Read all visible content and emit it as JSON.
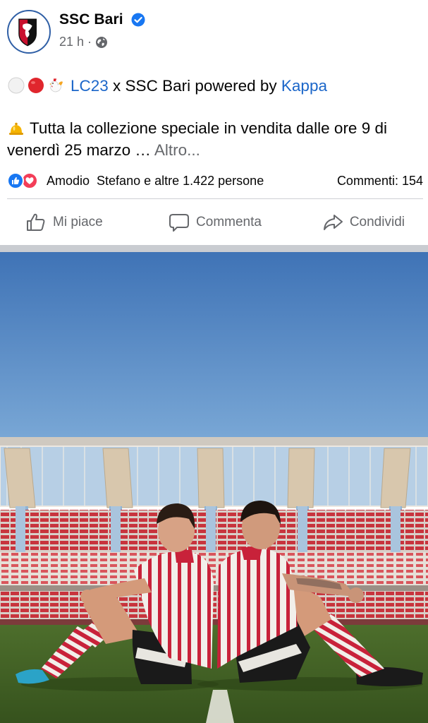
{
  "post": {
    "page_name": "SSC Bari",
    "time": "21 h",
    "separator": "·",
    "line1": {
      "link_lc23": "LC23",
      "middle": " x SSC Bari powered by ",
      "link_kappa": "Kappa"
    },
    "line2": "Tutta la collezione speciale in vendita dalle ore 9 di",
    "line3": "venerdì 25 marzo …",
    "more_label": " Altro..."
  },
  "reactions": {
    "names": "Amodio  Stefano e altre 1.422 persone",
    "comments": "Commenti: 154"
  },
  "actions": {
    "like": "Mi piace",
    "comment": "Comment­a",
    "share": "Condividi"
  },
  "icons": {
    "verified": "verified-badge-icon",
    "globe": "globe-icon",
    "like": "thumbs-up-icon",
    "comment": "speech-bubble-icon",
    "share": "share-arrow-icon"
  },
  "colors": {
    "link": "#1b66c9",
    "secondary_text": "#65676b",
    "like_blue": "#1877f2",
    "love_red": "#f33e58",
    "brand_red": "#c8102e"
  }
}
